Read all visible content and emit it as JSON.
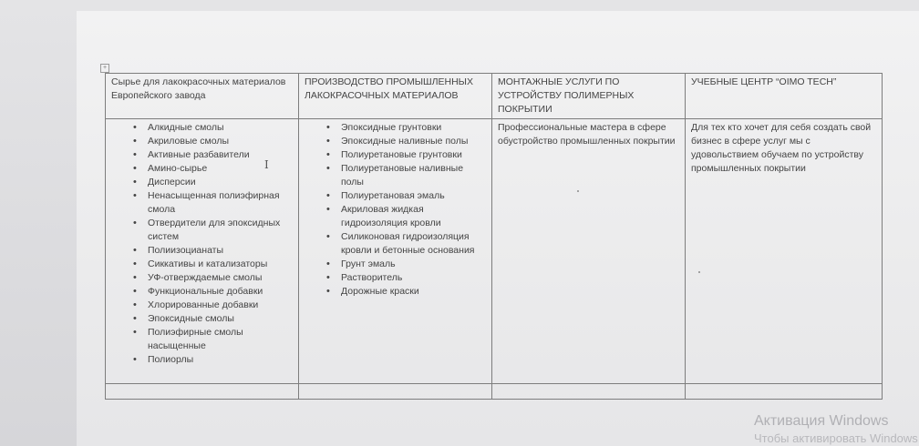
{
  "table": {
    "headers": [
      "Сырье для лакокрасочных материалов Европейского завода",
      "ПРОИЗВОДСТВО ПРОМЫШЛЕННЫХ ЛАКОКРАСОЧНЫХ МАТЕРИАЛОВ",
      "МОНТАЖНЫЕ УСЛУГИ ПО УСТРОЙСТВУ ПОЛИМЕРНЫХ ПОКРЫТИИ",
      "УЧЕБНЫЕ ЦЕНТР  “OIMO TECH”"
    ],
    "col1_items": [
      "Алкидные смолы",
      "Акриловые смолы",
      "Активные разбавители",
      "Амино-сырье",
      "Дисперсии",
      "Ненасыщенная полиэфирная смола",
      "Отвердители для эпоксидных систем",
      "Полиизоцианаты",
      "Сиккативы и катализаторы",
      "УФ-отверждаемые смолы",
      "Функциональные добавки",
      "Хлорированные добавки",
      "Эпоксидные смолы",
      "Полиэфирные смолы насыщенные",
      "Полиорлы"
    ],
    "col2_items": [
      "Эпоксидные грунтовки",
      "Эпоксидные наливные полы",
      "Полиуретановые грунтовки",
      "Полиуретановые наливные полы",
      "Полиуретановая эмаль",
      "Акриловая жидкая гидроизоляция кровли",
      "Силиконовая гидроизоляция кровли и бетонные основания",
      "Грунт эмаль",
      "Растворитель",
      "Дорожные краски"
    ],
    "col3_text": "Профессиональные мастера в сфере обустройство промышленных покрытии",
    "col4_text": "Для тех кто хочет для себя создать свой бизнес в сфере услуг мы с удовольствием обучаем по устройству промышленных покрытии"
  },
  "watermark": {
    "line1": "Активация Windows",
    "line2": "Чтобы активировать Windows"
  }
}
